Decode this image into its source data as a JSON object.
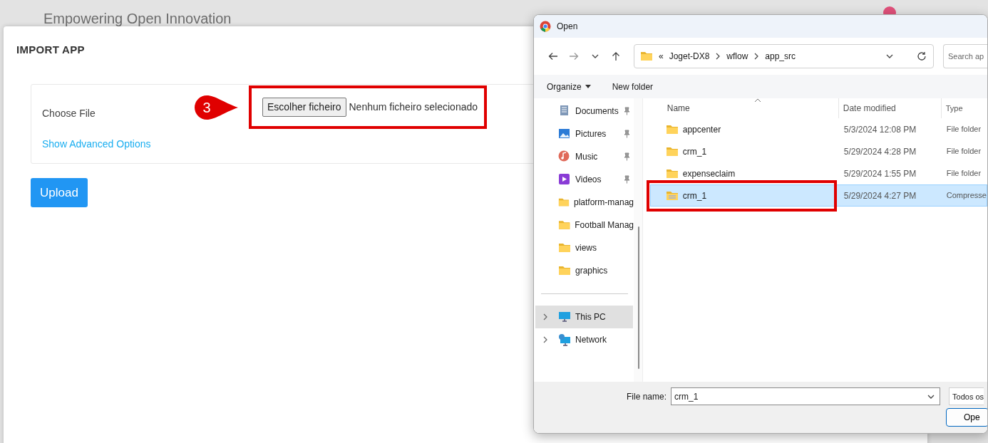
{
  "background_page": {
    "title": "Empowering Open Innovation"
  },
  "import_dialog": {
    "title": "IMPORT APP",
    "field_label": "Choose File",
    "file_button": "Escolher ficheiro",
    "file_status": "Nenhum ficheiro selecionado",
    "advanced_link": "Show Advanced Options",
    "upload_button": "Upload",
    "step_marker": "3"
  },
  "open_dialog": {
    "title": "Open",
    "path_prefix": "«",
    "path": [
      "Joget-DX8",
      "wflow",
      "app_src"
    ],
    "search_placeholder": "Search ap",
    "toolbar": [
      {
        "label": "Organize",
        "dropdown": true
      },
      {
        "label": "New folder",
        "dropdown": false
      }
    ],
    "nav_items": [
      {
        "label": "Documents",
        "kind": "documents",
        "pinned": true,
        "selected": false
      },
      {
        "label": "Pictures",
        "kind": "pictures",
        "pinned": true,
        "selected": false
      },
      {
        "label": "Music",
        "kind": "music",
        "pinned": true,
        "selected": false
      },
      {
        "label": "Videos",
        "kind": "videos",
        "pinned": true,
        "selected": false
      },
      {
        "label": "platform-manag",
        "kind": "folder",
        "pinned": false,
        "selected": false
      },
      {
        "label": "Football Manag",
        "kind": "folder",
        "pinned": false,
        "selected": false
      },
      {
        "label": "views",
        "kind": "folder",
        "pinned": false,
        "selected": false
      },
      {
        "label": "graphics",
        "kind": "folder",
        "pinned": false,
        "selected": false
      },
      {
        "label": "This PC",
        "kind": "pc",
        "pinned": false,
        "selected": true
      },
      {
        "label": "Network",
        "kind": "network",
        "pinned": false,
        "selected": false
      }
    ],
    "columns": [
      "Name",
      "Date modified",
      "Type"
    ],
    "rows": [
      {
        "name": "appcenter",
        "date": "5/3/2024 12:08 PM",
        "type": "File folder",
        "kind": "folder",
        "selected": false,
        "highlighted": false
      },
      {
        "name": "crm_1",
        "date": "5/29/2024 4:28 PM",
        "type": "File folder",
        "kind": "folder",
        "selected": false,
        "highlighted": false
      },
      {
        "name": "expenseclaim",
        "date": "5/29/2024 1:55 PM",
        "type": "File folder",
        "kind": "folder",
        "selected": false,
        "highlighted": false
      },
      {
        "name": "crm_1",
        "date": "5/29/2024 4:27 PM",
        "type": "Compresse",
        "kind": "zip",
        "selected": true,
        "highlighted": true
      }
    ],
    "file_name_label": "File name:",
    "file_name": "crm_1",
    "file_type": "Todos os",
    "open_button": "Ope"
  }
}
